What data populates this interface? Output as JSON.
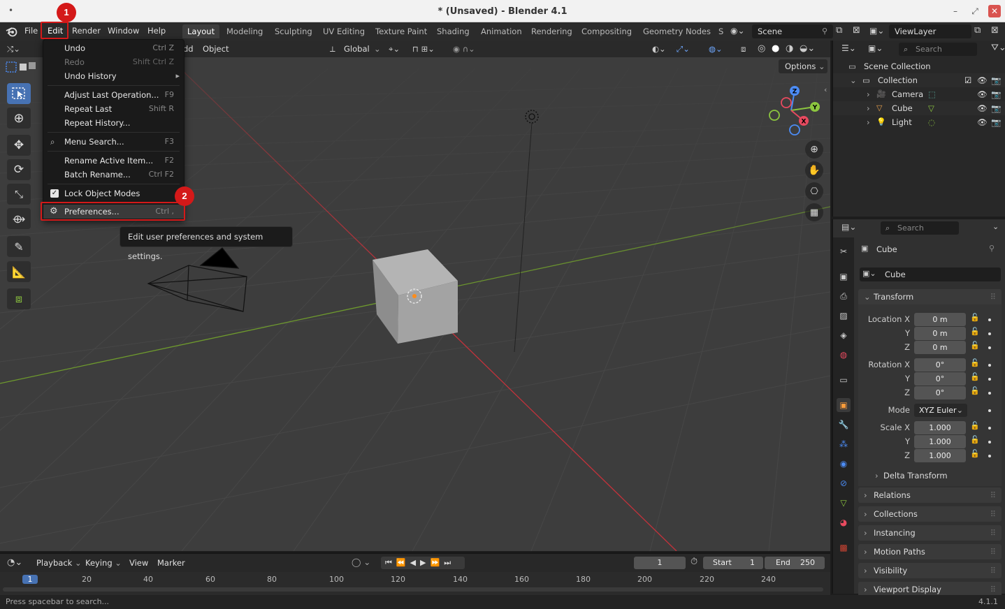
{
  "window": {
    "title": "* (Unsaved) - Blender 4.1",
    "dot": "•",
    "min": "–",
    "max": "⤢",
    "close": "✕"
  },
  "menubar": {
    "file": "File",
    "edit": "Edit",
    "render": "Render",
    "window": "Window",
    "help": "Help"
  },
  "workspaces": [
    "Layout",
    "Modeling",
    "Sculpting",
    "UV Editing",
    "Texture Paint",
    "Shading",
    "Animation",
    "Rendering",
    "Compositing",
    "Geometry Nodes",
    "S"
  ],
  "scene": "Scene",
  "view_layer": "ViewLayer",
  "viewport": {
    "add_label": "dd",
    "object_label": "Object",
    "orientation": "Global",
    "options": "Options"
  },
  "edit_menu": {
    "undo": {
      "label": "Undo",
      "shortcut": "Ctrl Z"
    },
    "redo": {
      "label": "Redo",
      "shortcut": "Shift Ctrl Z"
    },
    "undo_history": {
      "label": "Undo History"
    },
    "adjust_last": {
      "label": "Adjust Last Operation...",
      "shortcut": "F9"
    },
    "repeat_last": {
      "label": "Repeat Last",
      "shortcut": "Shift R"
    },
    "repeat_history": {
      "label": "Repeat History..."
    },
    "menu_search": {
      "label": "Menu Search...",
      "shortcut": "F3"
    },
    "rename_active": {
      "label": "Rename Active Item...",
      "shortcut": "F2"
    },
    "batch_rename": {
      "label": "Batch Rename...",
      "shortcut": "Ctrl F2"
    },
    "lock_modes": {
      "label": "Lock Object Modes",
      "checked": true
    },
    "preferences": {
      "label": "Preferences...",
      "shortcut": "Ctrl ,"
    }
  },
  "tooltip": "Edit user preferences and system settings.",
  "annotations": {
    "badge1": "1",
    "badge2": "2",
    "color": "#d41919"
  },
  "outliner": {
    "search_placeholder": "Search",
    "scene_collection": "Scene Collection",
    "collection": "Collection",
    "items": [
      {
        "name": "Camera",
        "icon": "camera-icon"
      },
      {
        "name": "Cube",
        "icon": "mesh-icon"
      },
      {
        "name": "Light",
        "icon": "light-icon"
      }
    ]
  },
  "properties": {
    "search_placeholder": "Search",
    "object_name": "Cube",
    "data_name": "Cube",
    "transform": {
      "header": "Transform",
      "location_label": "Location X",
      "rotation_label": "Rotation X",
      "scale_label": "Scale X",
      "y": "Y",
      "z": "Z",
      "location": [
        "0 m",
        "0 m",
        "0 m"
      ],
      "rotation": [
        "0°",
        "0°",
        "0°"
      ],
      "mode_label": "Mode",
      "mode": "XYZ Euler",
      "scale": [
        "1.000",
        "1.000",
        "1.000"
      ],
      "delta": "Delta Transform"
    },
    "panels": [
      "Relations",
      "Collections",
      "Instancing",
      "Motion Paths",
      "Visibility",
      "Viewport Display"
    ]
  },
  "timeline": {
    "playback": "Playback",
    "keying": "Keying",
    "view": "View",
    "marker": "Marker",
    "current_frame": "1",
    "start_label": "Start",
    "start": "1",
    "end_label": "End",
    "end": "250",
    "ruler": [
      "1",
      "20",
      "40",
      "60",
      "80",
      "100",
      "120",
      "140",
      "160",
      "180",
      "200",
      "220",
      "240"
    ]
  },
  "status": {
    "hint": "Press spacebar to search...",
    "version": "4.1.1"
  },
  "colors": {
    "accent": "#4772b3",
    "x_axis": "#c4323b",
    "y_axis": "#6e9a2d",
    "menu_bg": "#1a1a1a"
  }
}
